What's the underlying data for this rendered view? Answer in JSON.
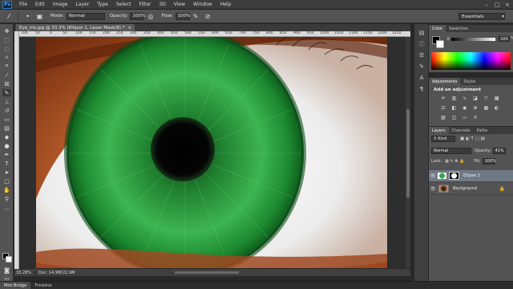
{
  "app": {
    "logo": "Ps"
  },
  "menu": [
    "File",
    "Edit",
    "Image",
    "Layer",
    "Type",
    "Select",
    "Filter",
    "3D",
    "View",
    "Window",
    "Help"
  ],
  "window_controls": [
    "–",
    "□",
    "×"
  ],
  "options": {
    "mode_label": "Mode:",
    "mode_value": "Normal",
    "opacity_label": "Opacity:",
    "opacity_value": "100%",
    "flow_label": "Flow:",
    "flow_value": "100%",
    "workspace": "Essentials"
  },
  "document": {
    "tab_title": "Eye_iris.jpg @ 33.3% (Ellipse 1, Layer Mask/8) *",
    "close": "×",
    "ruler_ticks": [
      "100",
      "50",
      "0",
      "50",
      "100",
      "150",
      "200",
      "250",
      "300",
      "350",
      "400",
      "450",
      "500",
      "550",
      "600",
      "650",
      "700",
      "750",
      "800",
      "850",
      "900",
      "950",
      "1000",
      "1050",
      "1100",
      "1150",
      "1200",
      "1250"
    ]
  },
  "status": {
    "zoom": "33.28%",
    "doc_size": "Doc: 14.9M/22.9M"
  },
  "bottom_tabs": [
    "Mini Bridge",
    "Timeline"
  ],
  "color_panel": {
    "tabs": [
      "Color",
      "Swatches"
    ],
    "channel": "K",
    "value": "100",
    "unit": "%"
  },
  "adjustments_panel": {
    "tabs": [
      "Adjustments",
      "Styles"
    ],
    "title": "Add an adjustment",
    "icons": [
      "brightness-icon",
      "levels-icon",
      "curves-icon",
      "exposure-icon",
      "vibrance-icon",
      "hue-icon",
      "color-balance-icon",
      "bw-icon",
      "photo-filter-icon",
      "channel-mixer-icon",
      "color-lookup-icon",
      "invert-icon",
      "posterize-icon",
      "threshold-icon",
      "gradient-map-icon",
      "selective-color-icon"
    ]
  },
  "layers_panel": {
    "tabs": [
      "Layers",
      "Channels",
      "Paths"
    ],
    "filter_label": "Kind",
    "blend_mode": "Normal",
    "opacity_label": "Opacity:",
    "opacity_value": "41%",
    "lock_label": "Lock:",
    "fill_label": "Fill:",
    "fill_value": "100%",
    "layers": [
      {
        "name": "Ellipse 1",
        "selected": true
      },
      {
        "name": "Background",
        "selected": false
      }
    ]
  }
}
